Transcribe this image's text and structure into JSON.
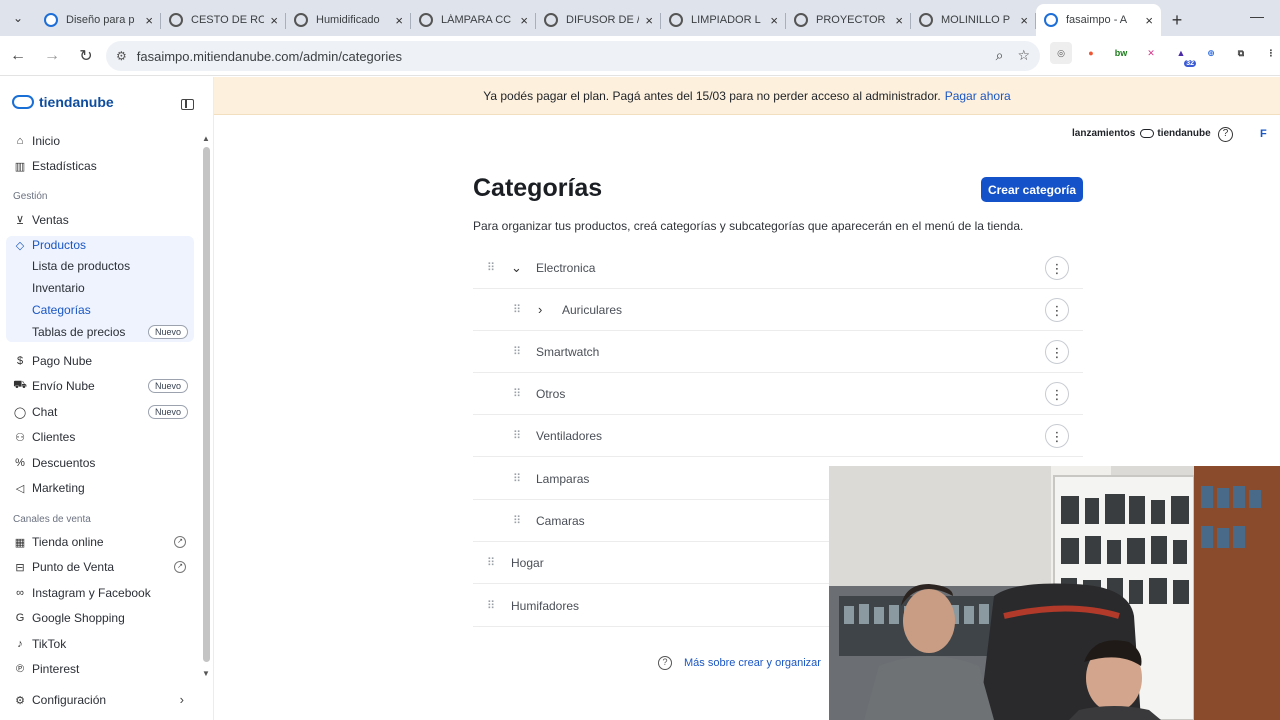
{
  "browser": {
    "tabs": [
      {
        "title": "Diseño para p",
        "active": false,
        "favicon": "tiendanube-icon"
      },
      {
        "title": "CESTO DE RC",
        "active": false,
        "favicon": "globe-icon"
      },
      {
        "title": "Humidificado",
        "active": false,
        "favicon": "globe-icon"
      },
      {
        "title": "LÁMPARA CC",
        "active": false,
        "favicon": "globe-icon"
      },
      {
        "title": "DIFUSOR DE /",
        "active": false,
        "favicon": "globe-icon"
      },
      {
        "title": "LIMPIADOR L",
        "active": false,
        "favicon": "globe-icon"
      },
      {
        "title": "PROYECTOR",
        "active": false,
        "favicon": "globe-icon"
      },
      {
        "title": "MOLINILLO P",
        "active": false,
        "favicon": "globe-icon"
      },
      {
        "title": "fasaimpo - A",
        "active": true,
        "favicon": "tiendanube-icon"
      }
    ],
    "url": "fasaimpo.mitiendanube.com/admin/categories",
    "extension_badge": "32"
  },
  "brand": {
    "name": "tiendanube"
  },
  "sidebar": {
    "inicio": "Inicio",
    "estadisticas": "Estadísticas",
    "gestion_label": "Gestión",
    "ventas": "Ventas",
    "productos": "Productos",
    "lista_productos": "Lista de productos",
    "inventario": "Inventario",
    "categorias": "Categorías",
    "tablas_precios": "Tablas de precios",
    "pago_nube": "Pago Nube",
    "envio_nube": "Envío Nube",
    "chat": "Chat",
    "clientes": "Clientes",
    "descuentos": "Descuentos",
    "marketing": "Marketing",
    "canales_label": "Canales de venta",
    "tienda_online": "Tienda online",
    "punto_venta": "Punto de Venta",
    "instagram": "Instagram y Facebook",
    "google": "Google Shopping",
    "tiktok": "TikTok",
    "pinterest": "Pinterest",
    "configuracion": "Configuración",
    "badge_nuevo": "Nuevo"
  },
  "banner": {
    "text": "Ya podés pagar el plan. Pagá antes del 15/03 para no perder acceso al administrador.",
    "link": "Pagar ahora"
  },
  "header": {
    "lanzamientos": "lanzamientos",
    "brand_small": "tiendanube",
    "user_initial": "F"
  },
  "main": {
    "title": "Categorías",
    "create_button": "Crear categoría",
    "description": "Para organizar tus productos, creá categorías y subcategorías que aparecerán en el menú de la tienda.",
    "categories": [
      {
        "name": "Electronica",
        "level": 1,
        "expanded": true
      },
      {
        "name": "Auriculares",
        "level": 2,
        "collapsed": true
      },
      {
        "name": "Smartwatch",
        "level": 2
      },
      {
        "name": "Otros",
        "level": 2
      },
      {
        "name": "Ventiladores",
        "level": 2
      },
      {
        "name": "Lamparas",
        "level": 2
      },
      {
        "name": "Camaras",
        "level": 2
      },
      {
        "name": "Hogar",
        "level": 1
      },
      {
        "name": "Humifadores",
        "level": 1
      }
    ],
    "more_link": "Más sobre crear y organizar"
  },
  "colors": {
    "primary": "#1452c9",
    "banner_bg": "#fdf0dd",
    "brand": "#1a6fd6"
  }
}
